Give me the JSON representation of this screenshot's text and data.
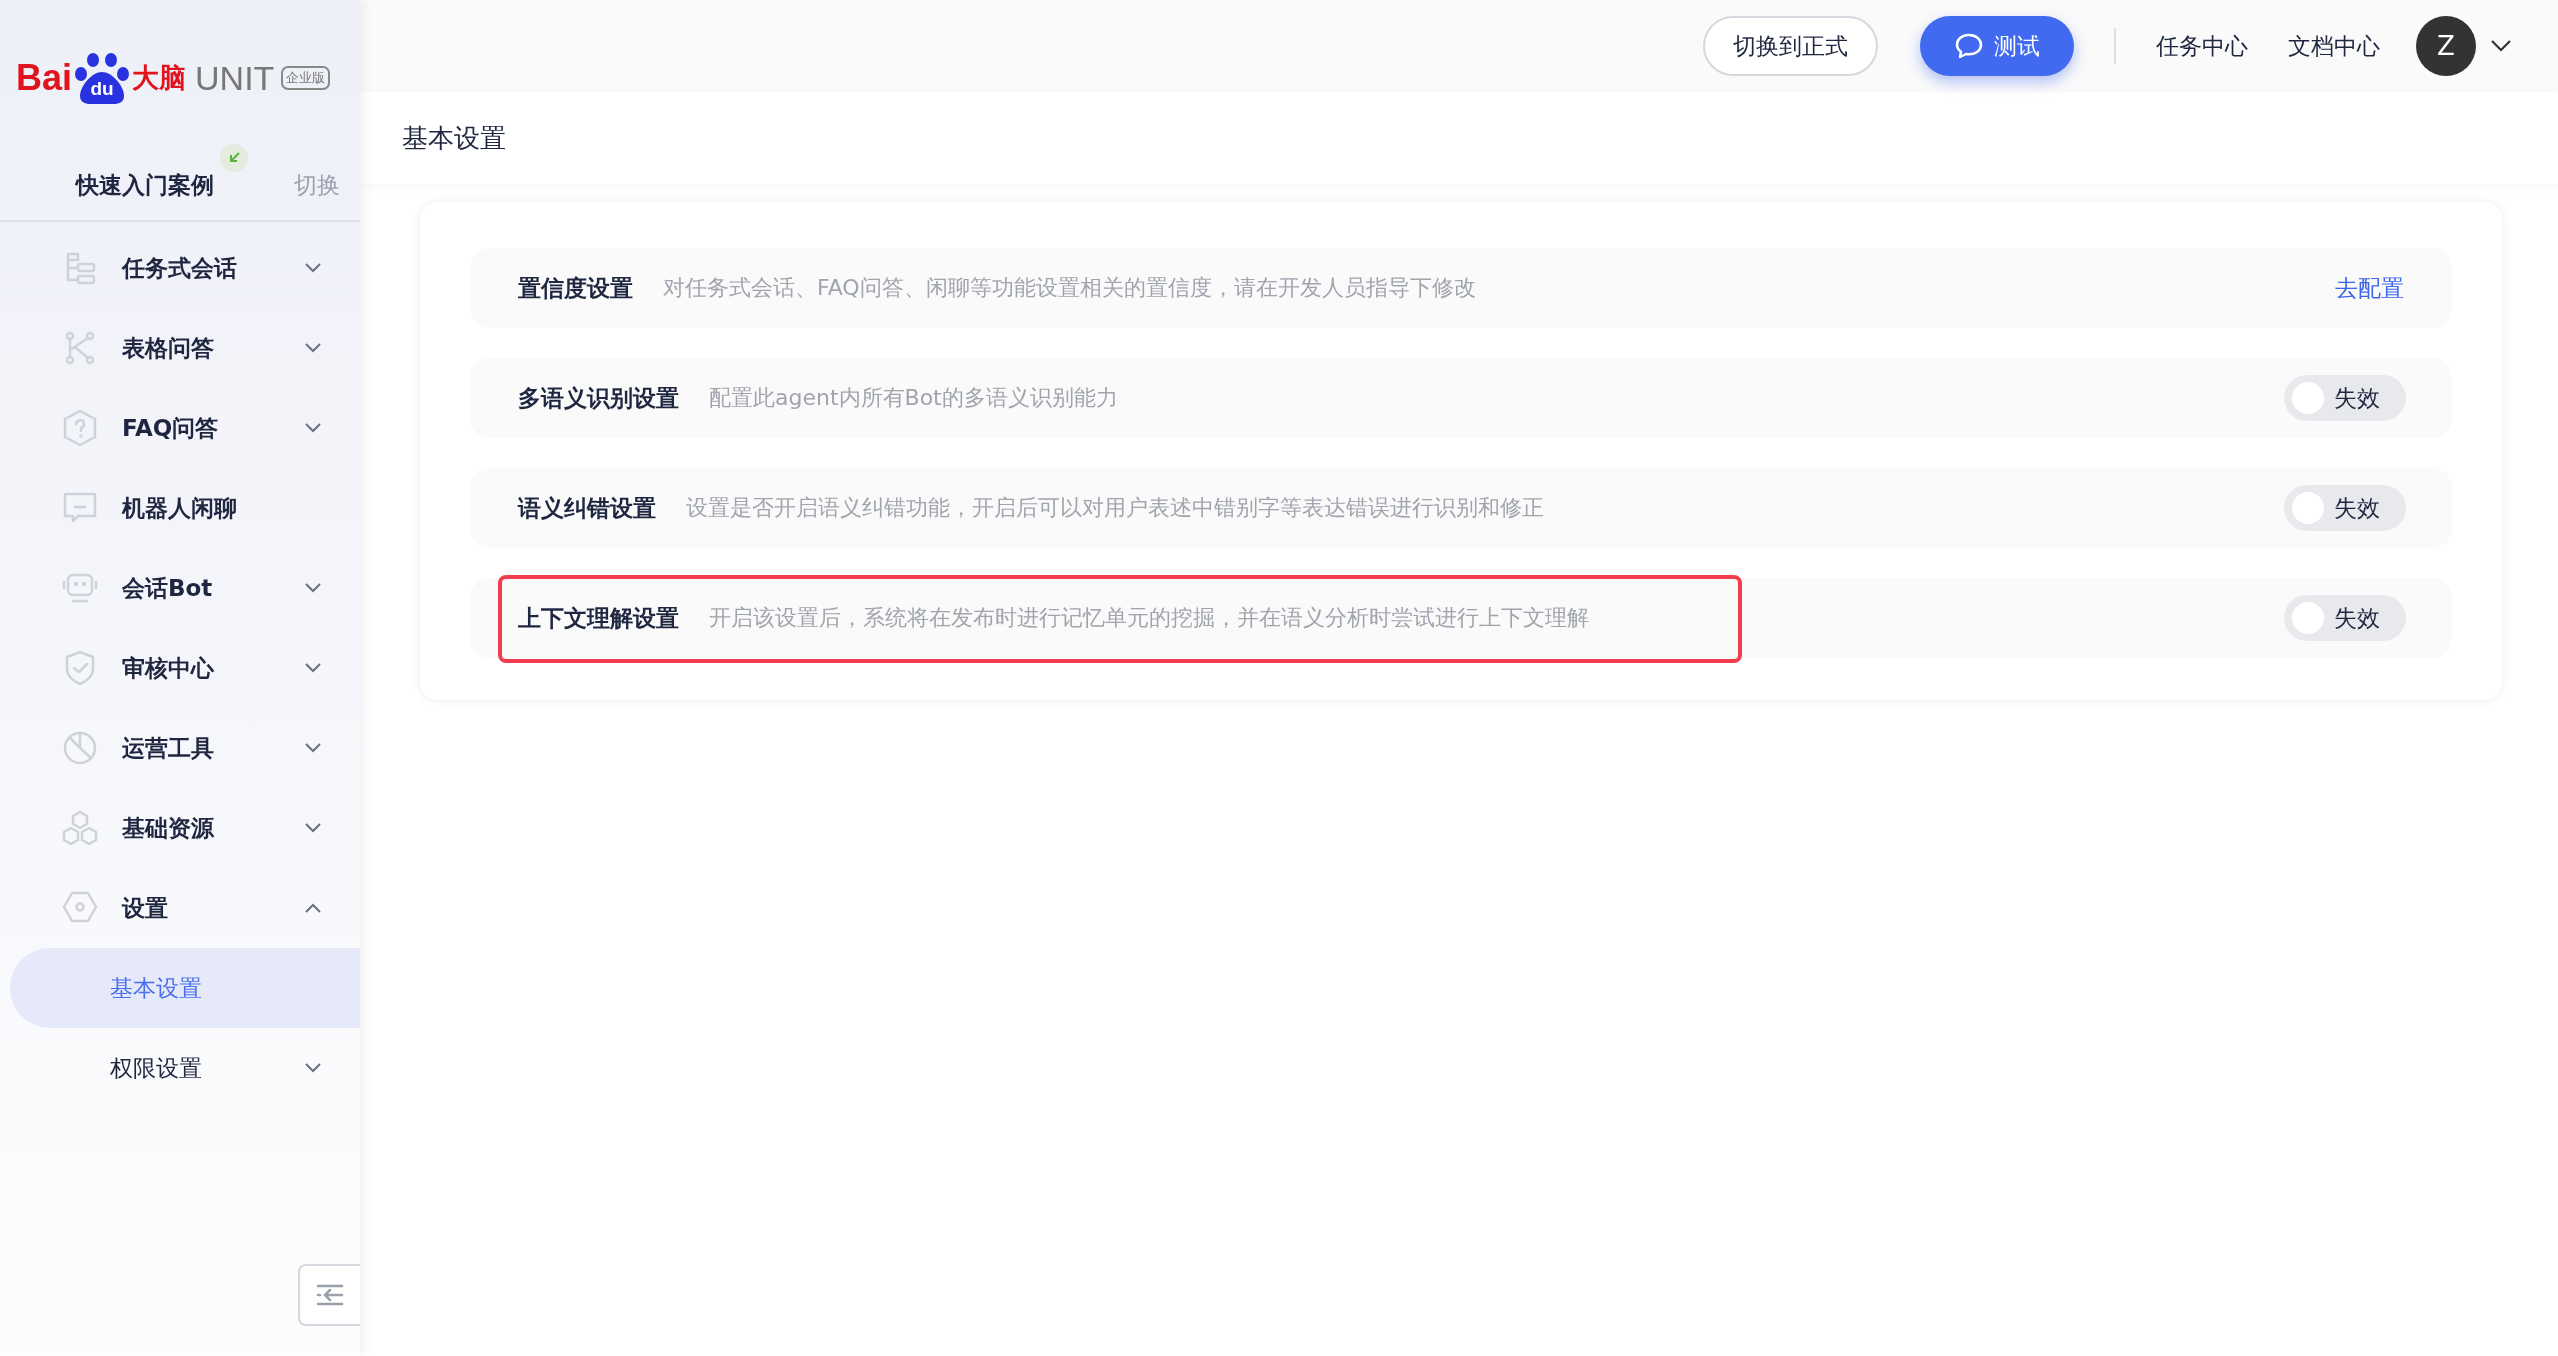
{
  "logo": {
    "brand_left": "Bai",
    "brand_paw": "du",
    "brand_right": "大脑",
    "product": "UNIT",
    "edition": "企业版"
  },
  "quick_start": {
    "label": "快速入门案例",
    "switch": "切换"
  },
  "sidebar": {
    "items": [
      {
        "label": "任务式会话",
        "kind": "group",
        "expanded": false
      },
      {
        "label": "表格问答",
        "kind": "group",
        "expanded": false
      },
      {
        "label": "FAQ问答",
        "kind": "group",
        "expanded": false
      },
      {
        "label": "机器人闲聊",
        "kind": "leaf"
      },
      {
        "label": "会话Bot",
        "kind": "group",
        "expanded": false
      },
      {
        "label": "审核中心",
        "kind": "group",
        "expanded": false
      },
      {
        "label": "运营工具",
        "kind": "group",
        "expanded": false
      },
      {
        "label": "基础资源",
        "kind": "group",
        "expanded": false
      },
      {
        "label": "设置",
        "kind": "group",
        "expanded": true,
        "children": [
          {
            "label": "基本设置",
            "kind": "leaf",
            "selected": true
          },
          {
            "label": "权限设置",
            "kind": "group",
            "expanded": false,
            "selected": false
          }
        ]
      }
    ]
  },
  "topbar": {
    "switch_button": "切换到正式",
    "test_button": "测试",
    "links": [
      "任务中心",
      "文档中心"
    ],
    "avatar": "Z"
  },
  "page_title": "基本设置",
  "settings": [
    {
      "title": "置信度设置",
      "description": "对任务式会话、FAQ问答、闲聊等功能设置相关的置信度，请在开发人员指导下修改",
      "kind": "link",
      "action": "去配置",
      "highlighted": false
    },
    {
      "title": "多语义识别设置",
      "description": "配置此agent内所有Bot的多语义识别能力",
      "kind": "toggle",
      "on": false,
      "state_label": "失效",
      "highlighted": false
    },
    {
      "title": "语义纠错设置",
      "description": "设置是否开启语义纠错功能，开启后可以对用户表述中错别字等表达错误进行识别和修正",
      "kind": "toggle",
      "on": false,
      "state_label": "失效",
      "highlighted": false
    },
    {
      "title": "上下文理解设置",
      "description": "开启该设置后，系统将在发布时进行记忆单元的挖掘，并在语义分析时尝试进行上下文理解",
      "kind": "toggle",
      "on": false,
      "state_label": "失效",
      "highlighted": true
    }
  ]
}
